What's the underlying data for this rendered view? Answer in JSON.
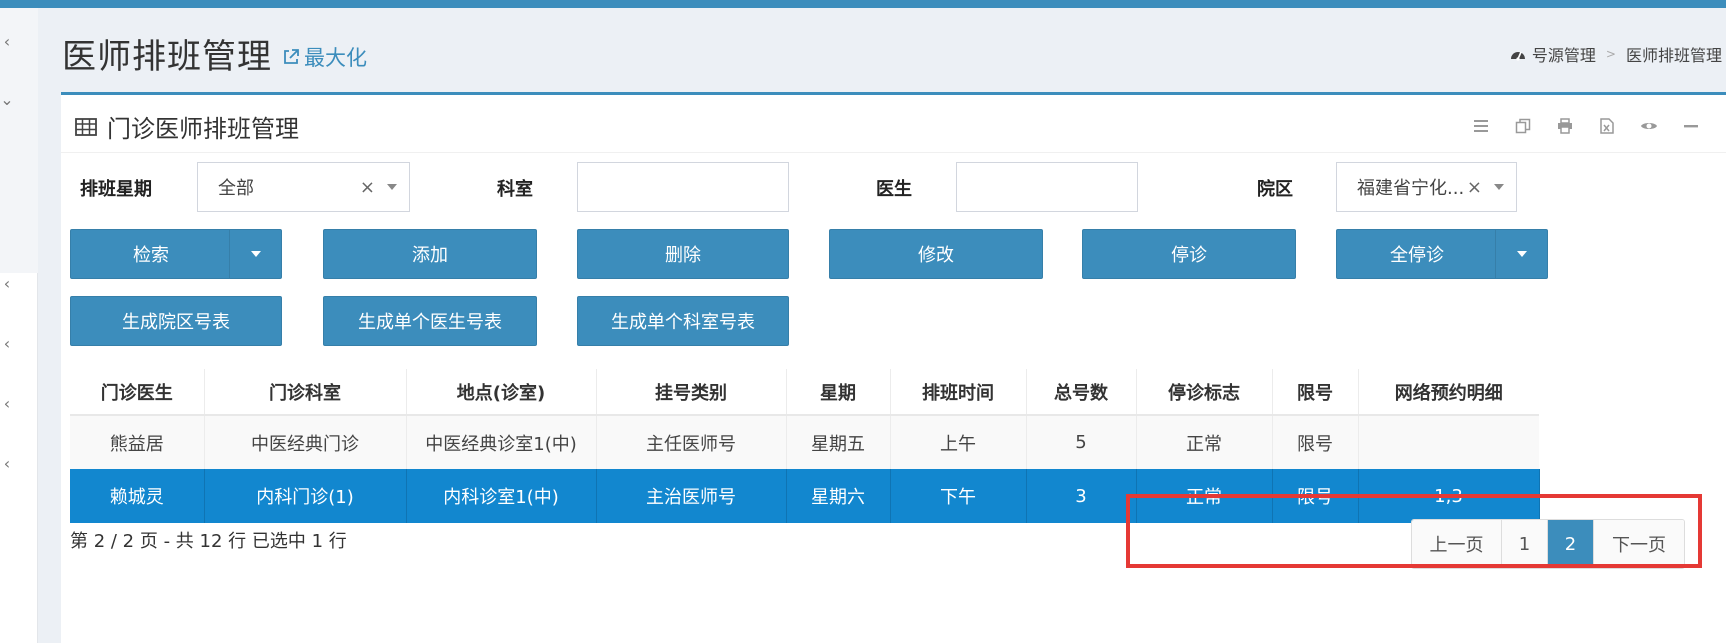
{
  "header": {
    "title": "医师排班管理",
    "maximize_label": "最大化"
  },
  "breadcrumb": {
    "items": [
      "号源管理",
      "医师排班管理"
    ]
  },
  "box": {
    "title": "门诊医师排班管理",
    "tools": [
      "list-icon",
      "copy-icon",
      "print-icon",
      "excel-icon",
      "eye-icon",
      "minimize-icon"
    ]
  },
  "filters": {
    "weekday_label": "排班星期",
    "weekday_value": "全部",
    "dept_label": "科室",
    "doctor_label": "医生",
    "campus_label": "院区",
    "campus_value": "福建省宁化..."
  },
  "buttons": {
    "search": "检索",
    "add": "添加",
    "delete": "删除",
    "edit": "修改",
    "suspend": "停诊",
    "suspend_all": "全停诊",
    "gen_campus": "生成院区号表",
    "gen_doctor": "生成单个医生号表",
    "gen_dept": "生成单个科室号表"
  },
  "table": {
    "columns": [
      "门诊医生",
      "门诊科室",
      "地点(诊室)",
      "挂号类别",
      "星期",
      "排班时间",
      "总号数",
      "停诊标志",
      "限号",
      "网络预约明细"
    ],
    "rows": [
      [
        "熊益居",
        "中医经典门诊",
        "中医经典诊室1(中)",
        "主任医师号",
        "星期五",
        "上午",
        "5",
        "正常",
        "限号",
        ""
      ],
      [
        "赖城灵",
        "内科门诊(1)",
        "内科诊室1(中)",
        "主治医师号",
        "星期六",
        "下午",
        "3",
        "正常",
        "限号",
        "1,3"
      ]
    ]
  },
  "footer": {
    "page_info": "第 2 / 2 页 - 共 12 行   已选中 1 行",
    "prev": "上一页",
    "pages": [
      "1",
      "2"
    ],
    "next": "下一页"
  },
  "colors": {
    "primary": "#3c8dbc",
    "selected_row": "#1287cf",
    "highlight": "#e53935"
  }
}
